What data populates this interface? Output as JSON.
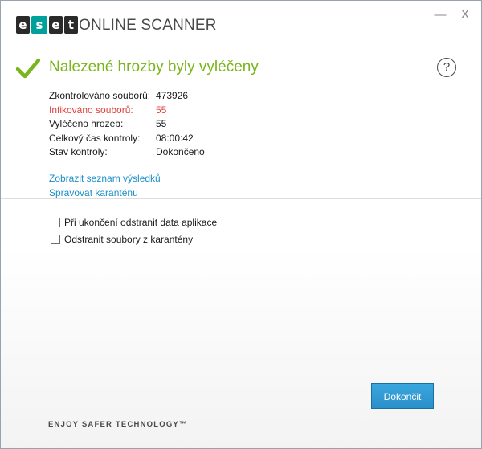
{
  "header": {
    "logo_letters": [
      "e",
      "s",
      "e",
      "t"
    ],
    "product_name": "ONLINE SCANNER",
    "minimize_glyph": "—",
    "close_glyph": "X"
  },
  "result": {
    "icon": "checkmark-icon",
    "title": "Nalezené hrozby byly vyléčeny",
    "help_glyph": "?"
  },
  "stats": [
    {
      "label": "Zkontrolováno souborů:",
      "value": "473926"
    },
    {
      "label": "Infikováno souborů:",
      "value": "55"
    },
    {
      "label": "Vyléčeno hrozeb:",
      "value": "55"
    },
    {
      "label": "Celkový čas kontroly:",
      "value": "08:00:42"
    },
    {
      "label": "Stav kontroly:",
      "value": "Dokončeno"
    }
  ],
  "links": {
    "show_results": "Zobrazit seznam výsledků",
    "manage_quarantine": "Spravovat karanténu"
  },
  "options": [
    {
      "label": "Při ukončení odstranit data aplikace",
      "checked": false
    },
    {
      "label": "Odstranit soubory z karantény",
      "checked": false
    }
  ],
  "finish_button": "Dokončit",
  "footer": "ENJOY SAFER TECHNOLOGY™",
  "colors": {
    "accent_green": "#7ab51d",
    "danger_red": "#e0403a",
    "link_blue": "#1e8fc8",
    "button_blue": "#2b8fca",
    "eset_teal": "#00a19a"
  }
}
